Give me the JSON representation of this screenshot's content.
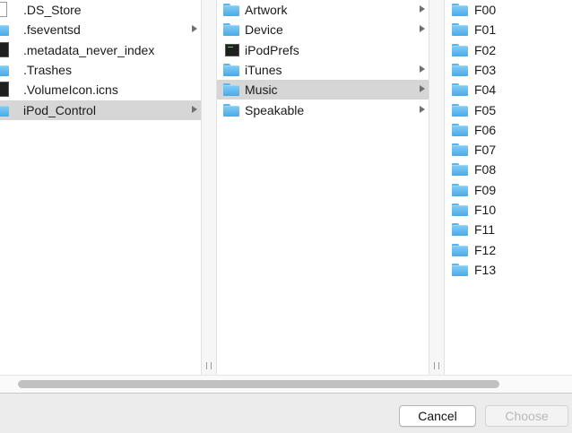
{
  "columns": {
    "col1": [
      {
        "label": ".DS_Store",
        "icon": "document-icon",
        "selected": false,
        "has_children": false
      },
      {
        "label": ".fseventsd",
        "icon": "folder-icon",
        "selected": false,
        "has_children": true
      },
      {
        "label": ".metadata_never_index",
        "icon": "black-file-icon",
        "selected": false,
        "has_children": false
      },
      {
        "label": ".Trashes",
        "icon": "folder-icon",
        "selected": false,
        "has_children": false
      },
      {
        "label": ".VolumeIcon.icns",
        "icon": "black-file-icon",
        "selected": false,
        "has_children": false
      },
      {
        "label": "iPod_Control",
        "icon": "folder-icon",
        "selected": true,
        "has_children": true
      }
    ],
    "col2": [
      {
        "label": "Artwork",
        "icon": "folder-icon",
        "selected": false,
        "has_children": true
      },
      {
        "label": "Device",
        "icon": "folder-icon",
        "selected": false,
        "has_children": true
      },
      {
        "label": "iPodPrefs",
        "icon": "terminal-file-icon",
        "selected": false,
        "has_children": false
      },
      {
        "label": "iTunes",
        "icon": "folder-icon",
        "selected": false,
        "has_children": true
      },
      {
        "label": "Music",
        "icon": "folder-icon",
        "selected": true,
        "has_children": true
      },
      {
        "label": "Speakable",
        "icon": "folder-icon",
        "selected": false,
        "has_children": true
      }
    ],
    "col3": [
      {
        "label": "F00",
        "icon": "folder-icon"
      },
      {
        "label": "F01",
        "icon": "folder-icon"
      },
      {
        "label": "F02",
        "icon": "folder-icon"
      },
      {
        "label": "F03",
        "icon": "folder-icon"
      },
      {
        "label": "F04",
        "icon": "folder-icon"
      },
      {
        "label": "F05",
        "icon": "folder-icon"
      },
      {
        "label": "F06",
        "icon": "folder-icon"
      },
      {
        "label": "F07",
        "icon": "folder-icon"
      },
      {
        "label": "F08",
        "icon": "folder-icon"
      },
      {
        "label": "F09",
        "icon": "folder-icon"
      },
      {
        "label": "F10",
        "icon": "folder-icon"
      },
      {
        "label": "F11",
        "icon": "folder-icon"
      },
      {
        "label": "F12",
        "icon": "folder-icon"
      },
      {
        "label": "F13",
        "icon": "folder-icon"
      }
    ]
  },
  "buttons": {
    "cancel_label": "Cancel",
    "choose_label": "Choose",
    "choose_enabled": false
  },
  "colors": {
    "selection": "#d6d6d6",
    "folder": "#5bb4ec",
    "disabled_text": "#b8b8b8"
  }
}
